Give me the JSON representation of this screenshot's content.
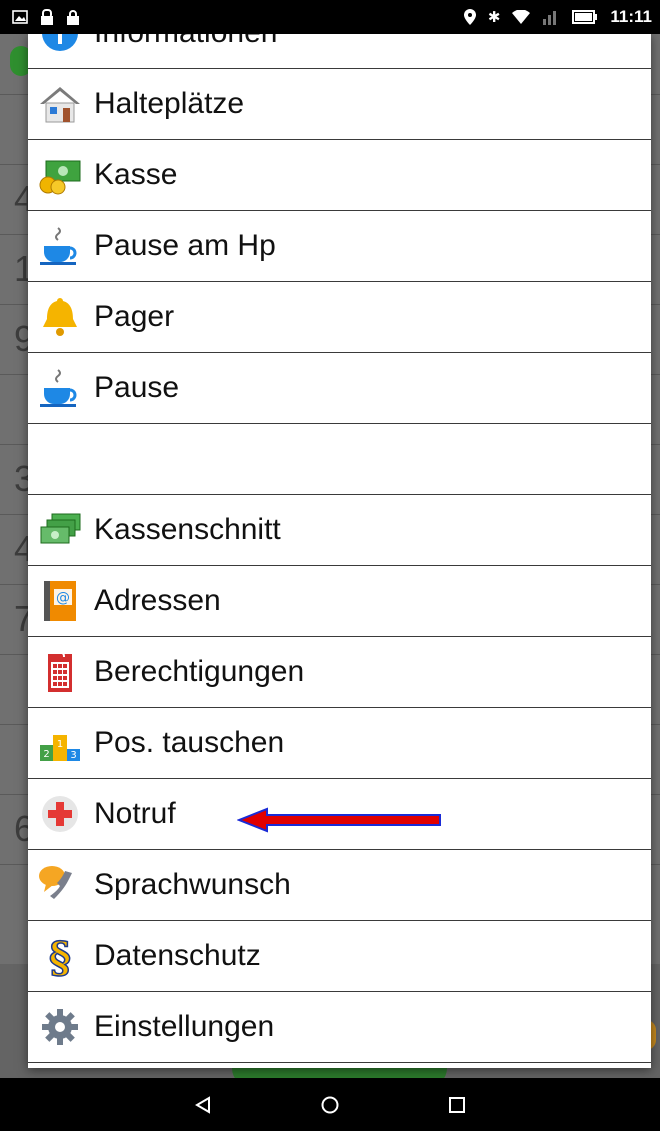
{
  "status_bar": {
    "time": "11:11",
    "left_icons": [
      "image-notification-icon",
      "lock-notification-icon",
      "lock-notification-icon"
    ],
    "right_icons": [
      "location-icon",
      "bluetooth-icon",
      "wifi-icon",
      "cell-signal-icon",
      "battery-icon"
    ]
  },
  "background_app": {
    "row_numbers": [
      "4",
      "1",
      "9",
      "",
      "3",
      "4",
      "7",
      "",
      "",
      "6"
    ]
  },
  "menu": {
    "items": [
      {
        "label": "Informationen",
        "icon": "info-icon"
      },
      {
        "label": "Halteplätze",
        "icon": "house-icon"
      },
      {
        "label": "Kasse",
        "icon": "money-coins-icon"
      },
      {
        "label": "Pause am Hp",
        "icon": "coffee-cup-icon"
      },
      {
        "label": "Pager",
        "icon": "bell-icon"
      },
      {
        "label": "Pause",
        "icon": "coffee-cup-icon"
      },
      {
        "label": "",
        "icon": ""
      },
      {
        "label": "Kassenschnitt",
        "icon": "money-stack-icon"
      },
      {
        "label": "Adressen",
        "icon": "address-book-icon"
      },
      {
        "label": "Berechtigungen",
        "icon": "phone-list-icon"
      },
      {
        "label": "Pos. tauschen",
        "icon": "podium-icon"
      },
      {
        "label": "Notruf",
        "icon": "red-cross-icon"
      },
      {
        "label": "Sprachwunsch",
        "icon": "speech-phone-icon"
      },
      {
        "label": "Datenschutz",
        "icon": "paragraph-icon"
      },
      {
        "label": "Einstellungen",
        "icon": "gear-icon"
      }
    ]
  },
  "navigation_bar": {
    "buttons": [
      "back-icon",
      "home-icon",
      "recents-icon"
    ]
  },
  "colors": {
    "annotation_arrow": "#e00000",
    "annotation_arrow_outline": "#1a2bd6"
  }
}
